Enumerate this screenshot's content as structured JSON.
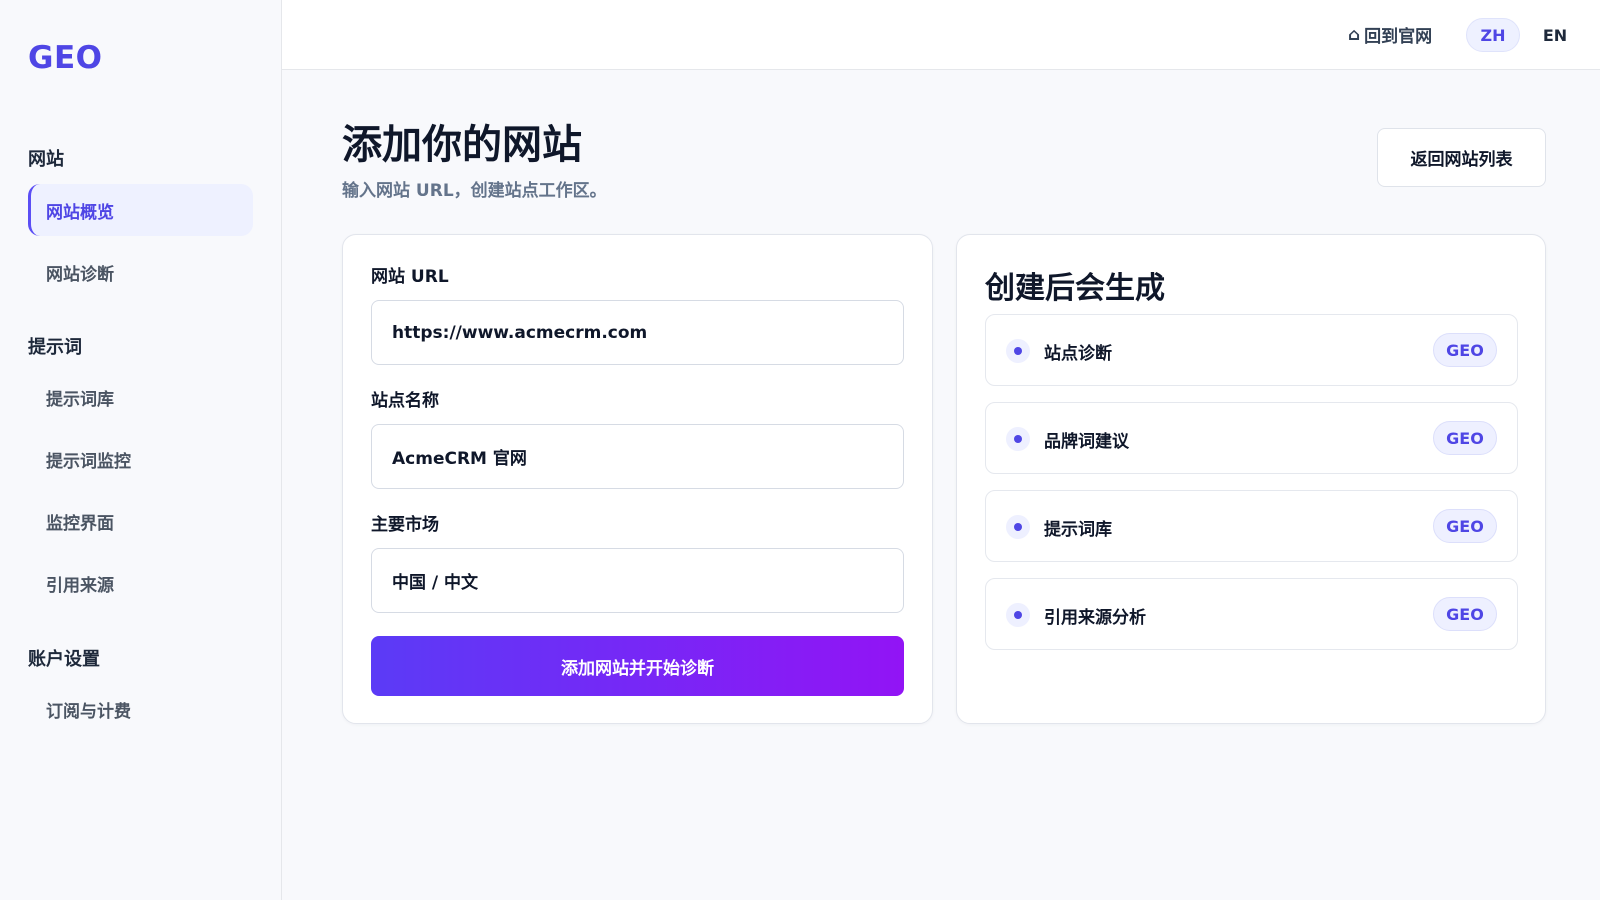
{
  "brand": {
    "logo": "GEO"
  },
  "sidebar": {
    "sections": [
      {
        "title": "网站",
        "items": [
          {
            "label": "网站概览",
            "active": true
          },
          {
            "label": "网站诊断"
          }
        ]
      },
      {
        "title": "提示词",
        "items": [
          {
            "label": "提示词库"
          },
          {
            "label": "提示词监控"
          },
          {
            "label": "监控界面"
          },
          {
            "label": "引用来源"
          }
        ]
      },
      {
        "title": "账户设置",
        "items": [
          {
            "label": "订阅与计费"
          }
        ]
      }
    ]
  },
  "topbar": {
    "home_icon": "⌂",
    "home_label": "回到官网",
    "lang_zh": "ZH",
    "lang_en": "EN",
    "active_lang": "ZH"
  },
  "page": {
    "title": "添加你的网站",
    "subtitle": "输入网站 URL，创建站点工作区。",
    "back_button": "返回网站列表"
  },
  "form": {
    "url_label": "网站 URL",
    "url_value": "https://www.acmecrm.com",
    "name_label": "站点名称",
    "name_value": "AcmeCRM 官网",
    "market_label": "主要市场",
    "market_value": "中国 / 中文",
    "submit_label": "添加网站并开始诊断"
  },
  "generated": {
    "title": "创建后会生成",
    "items": [
      {
        "label": "站点诊断",
        "badge": "GEO"
      },
      {
        "label": "品牌词建议",
        "badge": "GEO"
      },
      {
        "label": "提示词库",
        "badge": "GEO"
      },
      {
        "label": "引用来源分析",
        "badge": "GEO"
      }
    ]
  },
  "colors": {
    "accent": "#4f46e5",
    "button_gradient_start": "#5b3bf6",
    "button_gradient_end": "#9214f5",
    "active_nav_bg": "#eef1ff"
  }
}
